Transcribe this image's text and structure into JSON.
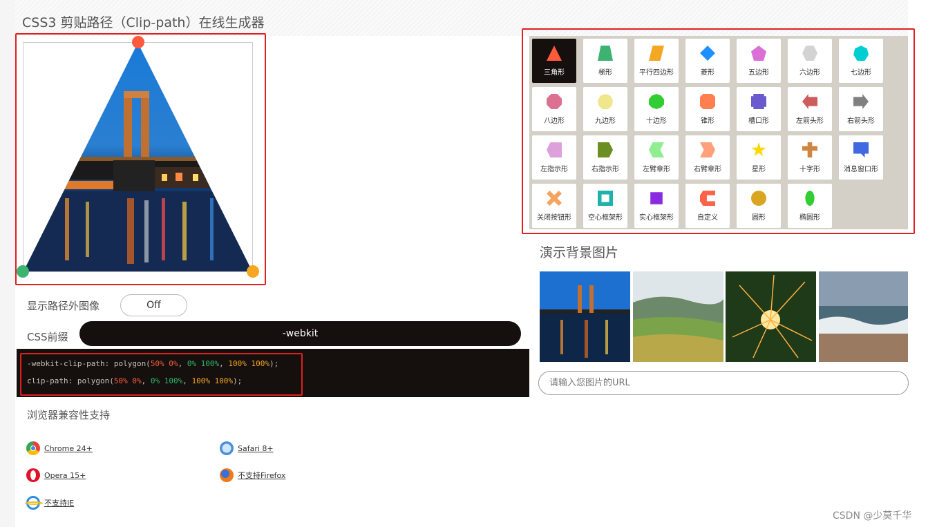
{
  "page": {
    "title": "CSS3 剪贴路径（Clip-path）在线生成器"
  },
  "controls": {
    "show_outside_label": "显示路径外图像",
    "show_outside_value": "Off",
    "prefix_label": "CSS前缀",
    "prefix_value": "-webkit"
  },
  "code": {
    "line1_prefix": "-webkit-clip-path: polygon(",
    "line2_prefix": "clip-path: polygon(",
    "p1": "50% 0%",
    "p2": "0% 100%",
    "p3": "100% 100%",
    "sep": ", ",
    "suffix": ");"
  },
  "compat": {
    "title": "浏览器兼容性支持",
    "browsers": [
      {
        "label": "Chrome 24+",
        "icon": "chrome-icon"
      },
      {
        "label": "Safari 8+",
        "icon": "safari-icon"
      },
      {
        "label": "Opera 15+",
        "icon": "opera-icon"
      },
      {
        "label": "不支持Firefox",
        "icon": "firefox-icon"
      },
      {
        "label": "不支持IE",
        "icon": "ie-icon"
      }
    ]
  },
  "shapes": [
    {
      "label": "三角形",
      "icon": "triangle-icon",
      "color": "#ff5a3c"
    },
    {
      "label": "梯形",
      "icon": "trapezoid-icon",
      "color": "#3cb371"
    },
    {
      "label": "平行四边形",
      "icon": "parallelogram-icon",
      "color": "#f5a623"
    },
    {
      "label": "菱形",
      "icon": "rhombus-icon",
      "color": "#1e90ff"
    },
    {
      "label": "五边形",
      "icon": "pentagon-icon",
      "color": "#da70d6"
    },
    {
      "label": "六边形",
      "icon": "hexagon-icon",
      "color": "#d3d3d3"
    },
    {
      "label": "七边形",
      "icon": "heptagon-icon",
      "color": "#00ced1"
    },
    {
      "label": "八边形",
      "icon": "octagon-icon",
      "color": "#db7093"
    },
    {
      "label": "九边形",
      "icon": "nonagon-icon",
      "color": "#f0e68c"
    },
    {
      "label": "十边形",
      "icon": "decagon-icon",
      "color": "#32cd32"
    },
    {
      "label": "锥形",
      "icon": "bevel-icon",
      "color": "#ff7f50"
    },
    {
      "label": "槽口形",
      "icon": "rabbet-icon",
      "color": "#6a5acd"
    },
    {
      "label": "左箭头形",
      "icon": "left-arrow-icon",
      "color": "#cd5c5c"
    },
    {
      "label": "右箭头形",
      "icon": "right-arrow-icon",
      "color": "#808080"
    },
    {
      "label": "左指示形",
      "icon": "left-point-icon",
      "color": "#dda0dd"
    },
    {
      "label": "右指示形",
      "icon": "right-point-icon",
      "color": "#6b8e23"
    },
    {
      "label": "左臂章形",
      "icon": "left-chevron-icon",
      "color": "#90ee90"
    },
    {
      "label": "右臂章形",
      "icon": "right-chevron-icon",
      "color": "#ffa07a"
    },
    {
      "label": "星形",
      "icon": "star-icon",
      "color": "#ffd700"
    },
    {
      "label": "十字形",
      "icon": "cross-icon",
      "color": "#cd853f"
    },
    {
      "label": "消息窗口形",
      "icon": "message-icon",
      "color": "#4169e1"
    },
    {
      "label": "关闭按钮形",
      "icon": "close-icon",
      "color": "#f4a460"
    },
    {
      "label": "空心框架形",
      "icon": "frame-icon",
      "color": "#20b2aa"
    },
    {
      "label": "实心框架形",
      "icon": "solid-frame-icon",
      "color": "#8a2be2"
    },
    {
      "label": "自定义",
      "icon": "custom-icon",
      "color": "#ff6347"
    },
    {
      "label": "圆形",
      "icon": "circle-icon",
      "color": "#daa520"
    },
    {
      "label": "椭圆形",
      "icon": "ellipse-icon",
      "color": "#32cd32"
    }
  ],
  "demo": {
    "title": "演示背景图片",
    "url_placeholder": "请输入您图片的URL"
  },
  "watermark": "CSDN @少莫千华"
}
